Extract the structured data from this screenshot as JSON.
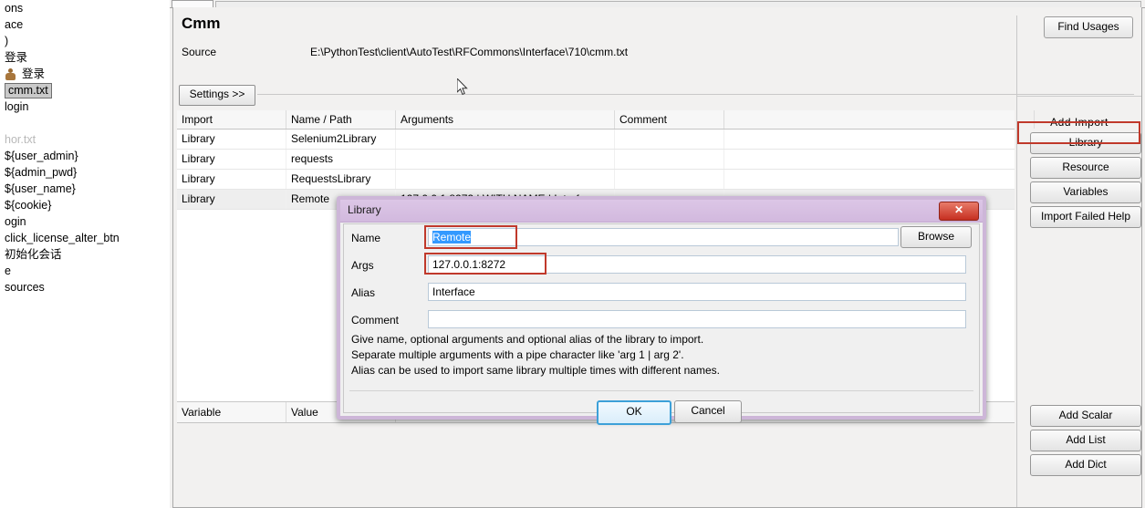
{
  "sidebar": {
    "items": [
      {
        "label": "ons",
        "icon": "",
        "state": "normal"
      },
      {
        "label": "ace",
        "icon": "",
        "state": "normal"
      },
      {
        "label": ")",
        "icon": "",
        "state": "normal"
      },
      {
        "label": "登录",
        "icon": "",
        "state": "normal"
      },
      {
        "label": "登录",
        "icon": "person-icon",
        "state": "normal"
      },
      {
        "label": "cmm.txt",
        "icon": "",
        "state": "selected"
      },
      {
        "label": "login",
        "icon": "gear-icon",
        "state": "normal"
      },
      {
        "label": "",
        "icon": "",
        "state": "spacer"
      },
      {
        "label": "hor.txt",
        "icon": "",
        "state": "faded"
      },
      {
        "label": "${user_admin}",
        "icon": "",
        "state": "normal"
      },
      {
        "label": "${admin_pwd}",
        "icon": "",
        "state": "normal"
      },
      {
        "label": "${user_name}",
        "icon": "",
        "state": "normal"
      },
      {
        "label": "${cookie}",
        "icon": "",
        "state": "normal"
      },
      {
        "label": "ogin",
        "icon": "",
        "state": "normal"
      },
      {
        "label": "click_license_alter_btn",
        "icon": "",
        "state": "normal"
      },
      {
        "label": "初始化会话",
        "icon": "",
        "state": "normal"
      },
      {
        "label": "e",
        "icon": "",
        "state": "normal"
      },
      {
        "label": "sources",
        "icon": "",
        "state": "normal"
      }
    ]
  },
  "editor": {
    "title": "Cmm",
    "find_usages_label": "Find Usages",
    "source_label": "Source",
    "source_value": "E:\\PythonTest\\client\\AutoTest\\RFCommons\\Interface\\710\\cmm.txt",
    "settings_button": "Settings >>"
  },
  "table": {
    "headers": [
      "Import",
      "Name / Path",
      "Arguments",
      "Comment",
      ""
    ],
    "rows": [
      {
        "import": "Library",
        "name": "Selenium2Library",
        "arguments": "",
        "comment": "",
        "extra": "",
        "selected": false
      },
      {
        "import": "Library",
        "name": "requests",
        "arguments": "",
        "comment": "",
        "extra": "",
        "selected": false
      },
      {
        "import": "Library",
        "name": "RequestsLibrary",
        "arguments": "",
        "comment": "",
        "extra": "",
        "selected": false
      },
      {
        "import": "Library",
        "name": "Remote",
        "arguments": "127.0.0.1:8272 | WITH NAME | Interface",
        "comment": "",
        "extra": "",
        "selected": true
      }
    ],
    "variable_headers": [
      "Variable",
      "Value"
    ]
  },
  "right_panel": {
    "add_import_label": "Add Import",
    "import_buttons": [
      "Library",
      "Resource",
      "Variables",
      "Import Failed Help"
    ],
    "variable_buttons": [
      "Add Scalar",
      "Add List",
      "Add Dict"
    ],
    "highlight_color": "#c0392b"
  },
  "dialog": {
    "title": "Library",
    "close_label": "✕",
    "fields": [
      {
        "label": "Name",
        "value": "Remote",
        "selected": true,
        "highlighted": true
      },
      {
        "label": "Args",
        "value": "127.0.0.1:8272",
        "selected": false,
        "highlighted": true
      },
      {
        "label": "Alias",
        "value": "Interface",
        "selected": false,
        "highlighted": false
      },
      {
        "label": "Comment",
        "value": "",
        "selected": false,
        "highlighted": false
      }
    ],
    "browse_label": "Browse",
    "help_lines": [
      "Give name, optional arguments and optional alias of the library to import.",
      "Separate multiple arguments with a pipe character like 'arg 1 | arg 2'.",
      "Alias can be used to import same library multiple times with different names."
    ],
    "ok_label": "OK",
    "cancel_label": "Cancel"
  }
}
